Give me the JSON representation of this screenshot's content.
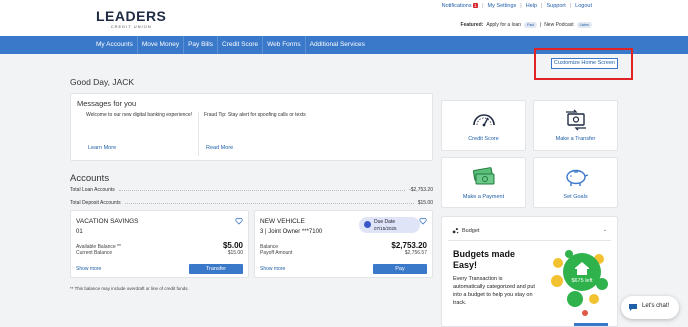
{
  "logo": {
    "main": "LEADERS",
    "sub": "CREDIT UNION"
  },
  "toplinks": {
    "notifications": "Notifications",
    "notifications_count": "1",
    "settings": "My Settings",
    "help": "Help",
    "support": "Support",
    "logout": "Logout"
  },
  "featured": {
    "label": "Featured:",
    "loan": "Apply for a loan",
    "loan_badge": "Fast",
    "podcast": "New Podcast",
    "podcast_badge": "Listen"
  },
  "nav": {
    "items": [
      "My Accounts",
      "Move Money",
      "Pay Bills",
      "Credit Score",
      "Web Forms",
      "Additional Services"
    ]
  },
  "customize": "Customize Home Screen",
  "greeting": "Good Day, JACK",
  "messages": {
    "title": "Messages for you",
    "items": [
      {
        "text": "Welcome to our new digital banking experience!",
        "link": "Learn More"
      },
      {
        "text": "Fraud Tip: Stay alert for spoofing calls or texts",
        "link": "Read More"
      }
    ]
  },
  "accounts": {
    "title": "Accounts",
    "total_loan_label": "Total Loan Accounts",
    "total_loan_value": "-$2,753.20",
    "total_deposit_label": "Total Deposit Accounts",
    "total_deposit_value": "$15.00",
    "cards": [
      {
        "name": "VACATION SAVINGS",
        "number": "01",
        "row1_label": "Available Balance **",
        "row1_value": "$5.00",
        "row2_label": "Current Balance",
        "row2_value": "$15.00",
        "show_more": "Show more",
        "action": "Transfer"
      },
      {
        "name": "NEW VEHICLE",
        "number": "3 | Joint Owner ***7100",
        "due_label": "Due Date",
        "due_date": "07/15/2025",
        "row1_label": "Balance",
        "row1_value": "$2,753.20",
        "row2_label": "Payoff Amount",
        "row2_value": "$2,756.57",
        "show_more": "Show more",
        "action": "Pay"
      }
    ],
    "footnote": "** This balance may include overdraft or line of credit funds."
  },
  "tiles": [
    {
      "label": "Credit Score",
      "icon": "gauge-icon"
    },
    {
      "label": "Make a Transfer",
      "icon": "transfer-icon"
    },
    {
      "label": "Make a Payment",
      "icon": "cash-icon"
    },
    {
      "label": "Set Goals",
      "icon": "piggy-bank-icon"
    }
  ],
  "budget": {
    "header": "Budget",
    "title": "Budgets made Easy!",
    "description": "Every Transaction is automatically categorized and put into a budget to help you stay on track.",
    "graphic_amount": "$675 left"
  },
  "chat": {
    "label": "Let's chat!"
  },
  "colors": {
    "nav": "#3a78c9",
    "link": "#1f5fa8",
    "alert": "#e02424",
    "budget_green": "#2fb24b",
    "budget_yellow": "#f2c230"
  }
}
